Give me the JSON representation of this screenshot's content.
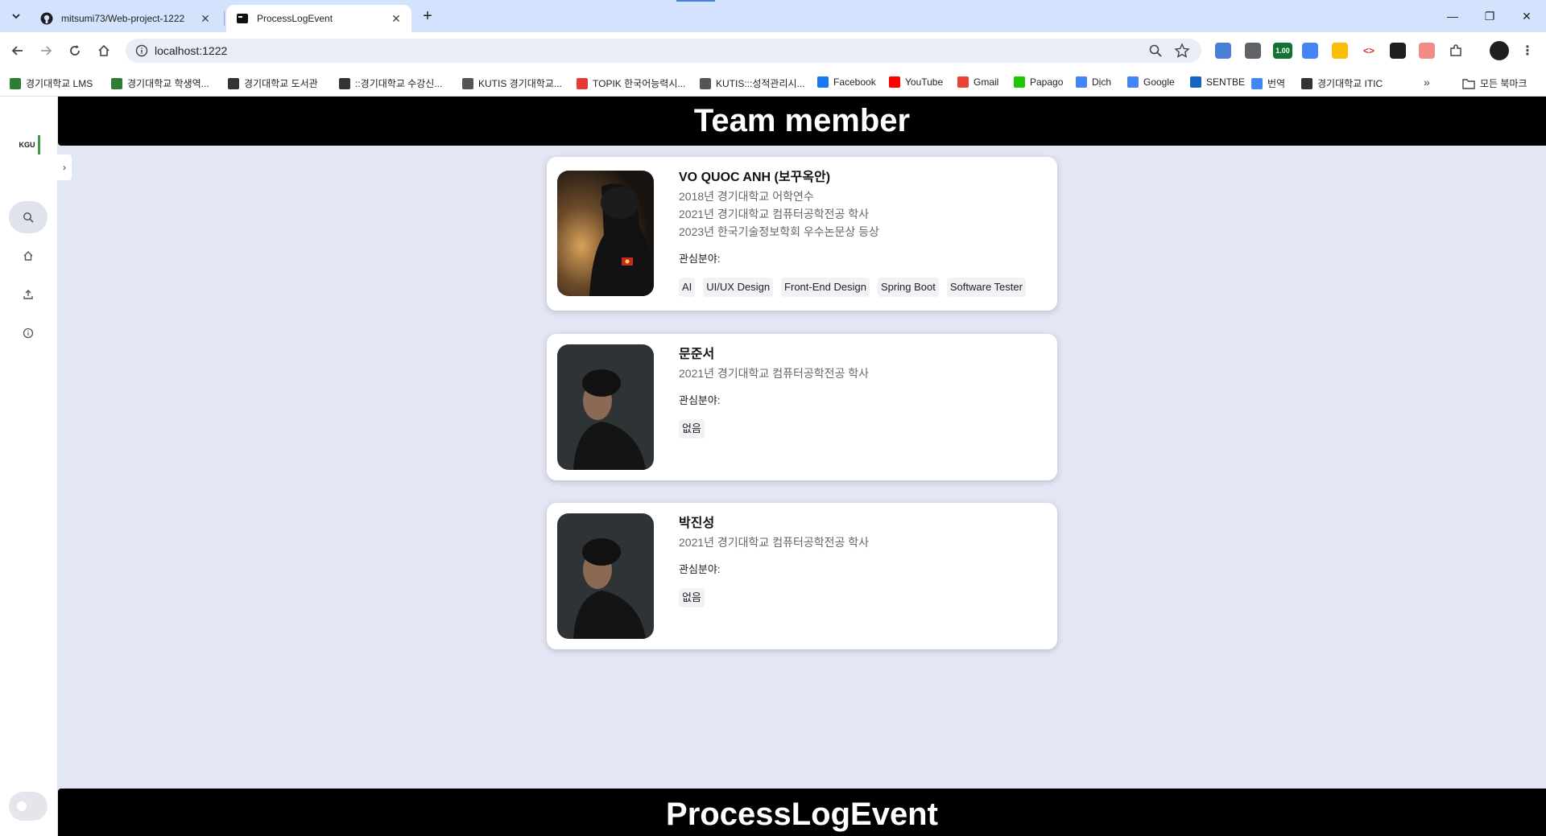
{
  "browser": {
    "tabs": [
      {
        "title": "mitsumi73/Web-project-1222",
        "close": "✕"
      },
      {
        "title": "ProcessLogEvent",
        "close": "✕"
      }
    ],
    "new_tab": "+",
    "window_controls": {
      "minimize": "—",
      "restore": "❐",
      "close": "✕"
    },
    "url": "localhost:1222",
    "extension_badge": "1.00",
    "bookmarks": [
      {
        "label": "경기대학교 LMS",
        "icon_color": "#2e7d32"
      },
      {
        "label": "경기대학교 학생역...",
        "icon_color": "#2e7d32"
      },
      {
        "label": "경기대학교 도서관",
        "icon_color": "#333333"
      },
      {
        "label": "::경기대학교 수강신...",
        "icon_color": "#333333"
      },
      {
        "label": "KUTIS 경기대학교...",
        "icon_color": "#555555"
      },
      {
        "label": "TOPIK 한국어능력시...",
        "icon_color": "#e53935"
      },
      {
        "label": "KUTIS:::성적관리시...",
        "icon_color": "#555555"
      },
      {
        "label": "Facebook",
        "icon_color": "#1877f2"
      },
      {
        "label": "YouTube",
        "icon_color": "#ff0000"
      },
      {
        "label": "Gmail",
        "icon_color": "#ea4335"
      },
      {
        "label": "Papago",
        "icon_color": "#1ec800"
      },
      {
        "label": "Dịch",
        "icon_color": "#4285f4"
      },
      {
        "label": "Google",
        "icon_color": "#4285f4"
      },
      {
        "label": "SENTBE",
        "icon_color": "#1565c0"
      },
      {
        "label": "번역",
        "icon_color": "#4285f4"
      },
      {
        "label": "경기대학교 ITIC",
        "icon_color": "#333333"
      }
    ],
    "bookmarks_more": "»",
    "all_bookmarks": "모든 북마크"
  },
  "sidebar": {
    "logo_text": "KGU",
    "expander": "›"
  },
  "page": {
    "header_title": "Team member",
    "footer_title": "ProcessLogEvent"
  },
  "members": [
    {
      "name": "VO QUOC ANH (보꾸옥안)",
      "history": [
        "2018년 경기대학교 어학연수",
        "2021년 경기대학교 컴퓨터공학전공 학사",
        "2023년 한국기술정보학회 우수논문상 등상"
      ],
      "interest_label": "관심분야:",
      "tags": [
        "AI",
        "UI/UX Design",
        "Front-End Design",
        "Spring Boot",
        "Software Tester"
      ]
    },
    {
      "name": "문준서",
      "history": [
        "2021년 경기대학교 컴퓨터공학전공 학사"
      ],
      "interest_label": "관심분야:",
      "tags": [
        "없음"
      ]
    },
    {
      "name": "박진성",
      "history": [
        "2021년 경기대학교 컴퓨터공학전공 학사"
      ],
      "interest_label": "관심분야:",
      "tags": [
        "없음"
      ]
    }
  ],
  "colors": {
    "page_bg": "#e3e6f5",
    "bar_bg": "#000000",
    "card_bg": "#ffffff",
    "tab_strip": "#d3e3fd"
  }
}
